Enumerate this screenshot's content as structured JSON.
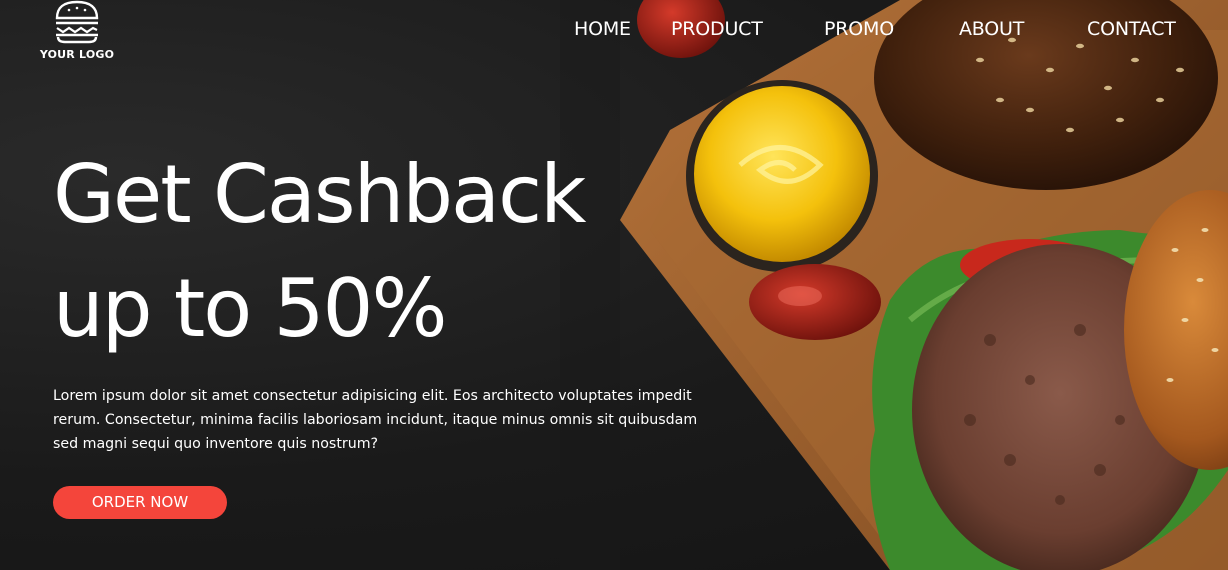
{
  "header": {
    "logo_text": "YOUR LOGO",
    "logo_icon": "burger-icon",
    "nav": [
      {
        "label": "HOME"
      },
      {
        "label": "PRODUCT"
      },
      {
        "label": "PROMO"
      },
      {
        "label": "ABOUT"
      },
      {
        "label": "CONTACT"
      }
    ]
  },
  "hero": {
    "headline_line1": "Get Cashback",
    "headline_line2": "up to 50%",
    "description": "Lorem ipsum dolor sit amet consectetur adipisicing elit. Eos architecto voluptates impedit rerum. Consectetur, minima facilis laboriosam incidunt, itaque minus omnis sit quibusdam sed magni sequi quo inventore quis nostrum?",
    "cta_label": "ORDER NOW"
  },
  "colors": {
    "background": "#1a1a1a",
    "accent": "#f4453b",
    "text": "#ffffff"
  }
}
